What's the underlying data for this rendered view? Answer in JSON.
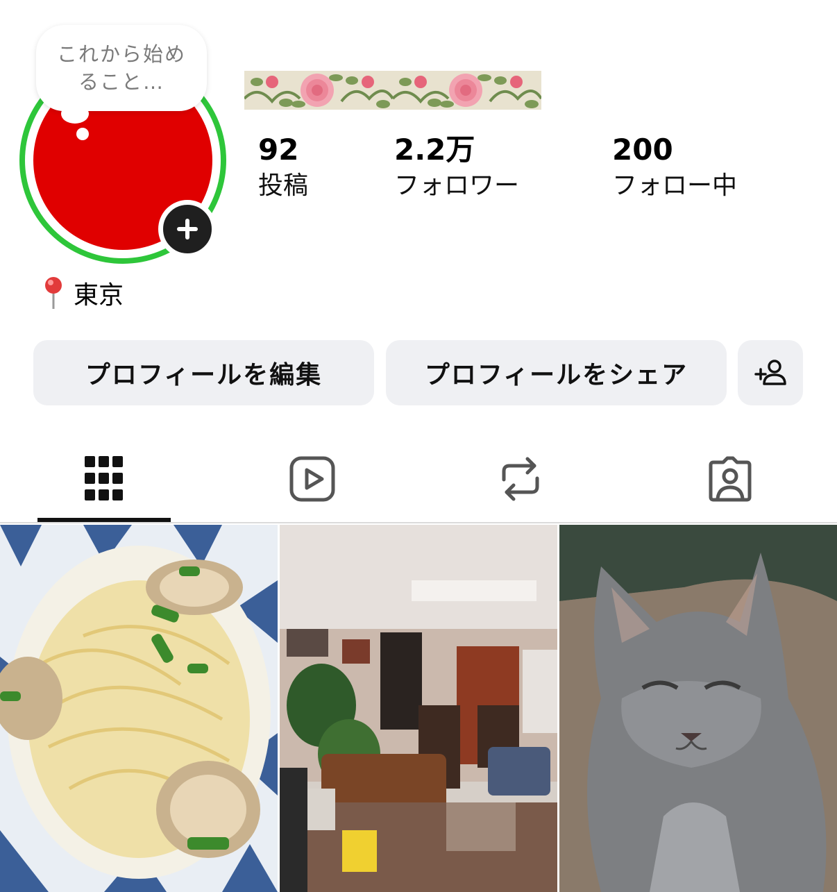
{
  "profile": {
    "note": "これから始めること…",
    "location_icon": "pin-icon",
    "location": "東京",
    "avatar_color": "#e00000",
    "story_ring_color": "#2ec63a"
  },
  "stats": {
    "posts": {
      "value": "92",
      "label": "投稿"
    },
    "followers": {
      "value": "2.2万",
      "label": "フォロワー"
    },
    "following": {
      "value": "200",
      "label": "フォロー中"
    }
  },
  "buttons": {
    "edit_profile": "プロフィールを編集",
    "share_profile": "プロフィールをシェア",
    "discover_people_icon": "add-person-icon"
  },
  "tabs": [
    {
      "icon": "grid-icon",
      "selected": true
    },
    {
      "icon": "reels-icon",
      "selected": false
    },
    {
      "icon": "repost-icon",
      "selected": false
    },
    {
      "icon": "tagged-icon",
      "selected": false
    }
  ],
  "posts": [
    {
      "subject": "pasta-with-clams"
    },
    {
      "subject": "living-room"
    },
    {
      "subject": "gray-cat"
    }
  ]
}
